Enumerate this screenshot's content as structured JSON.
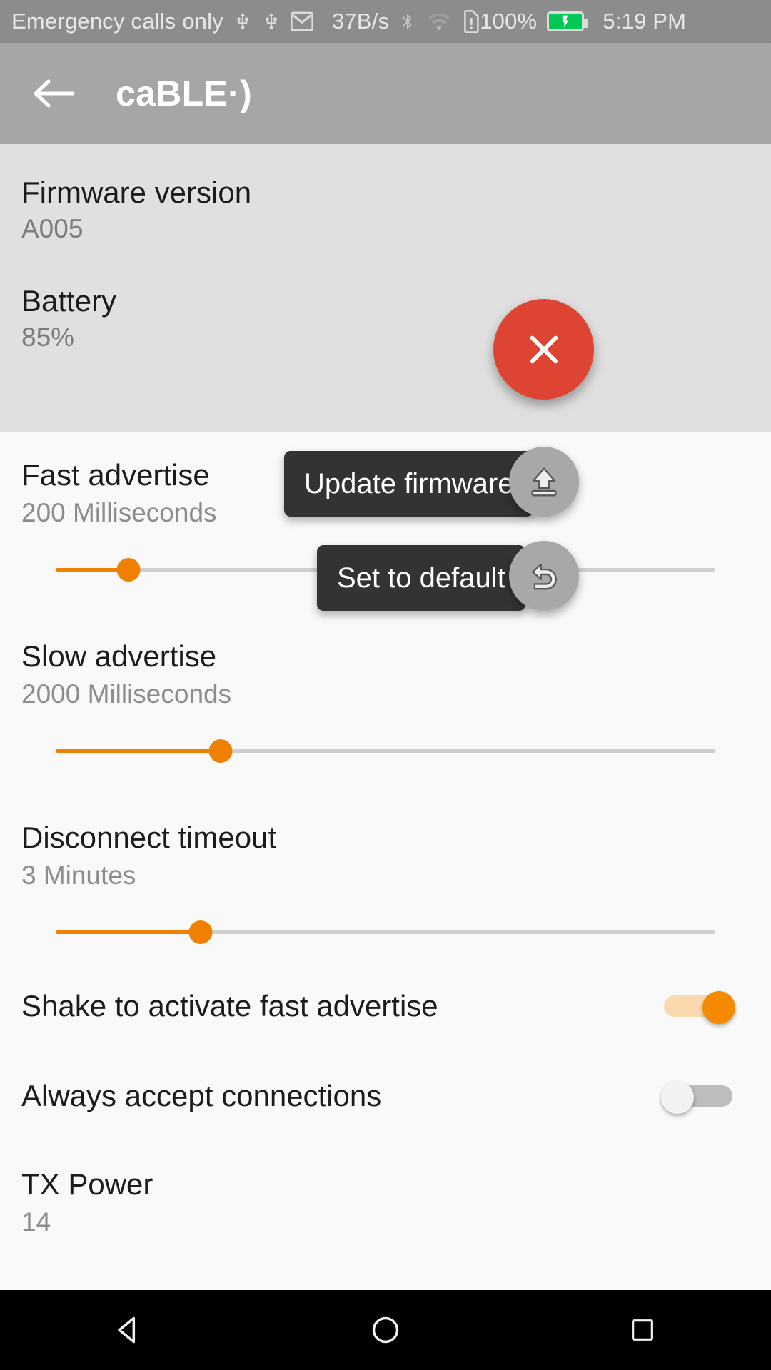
{
  "status_bar": {
    "carrier_text": "Emergency calls only",
    "icons": [
      "usb-icon",
      "usb-icon",
      "gmail-icon"
    ],
    "network_speed": "37B/s",
    "bluetooth_icon": "bluetooth-icon",
    "wifi_icon": "wifi-icon",
    "sim_alert_icon": "sim-card-alert-icon",
    "battery_percent": "100%",
    "battery_icon": "battery-charging-icon",
    "battery_color": "#00c853",
    "clock": "5:19 PM"
  },
  "app_bar": {
    "back_icon": "arrow-back-icon",
    "title": "caBLE·)"
  },
  "device_info": {
    "firmware": {
      "label": "Firmware version",
      "value": "A005"
    },
    "battery": {
      "label": "Battery",
      "value": "85%"
    }
  },
  "fab": {
    "close": {
      "icon": "close-icon",
      "color": "#dd4432"
    },
    "update_firmware": {
      "tooltip": "Update firmware",
      "icon": "upload-icon",
      "color": "#a8a8a8"
    },
    "set_to_default": {
      "tooltip": "Set to default",
      "icon": "undo-icon",
      "color": "#a8a8a8"
    }
  },
  "settings": {
    "accent_color": "#f08000",
    "sliders": [
      {
        "label": "Fast advertise",
        "value": "200 Milliseconds",
        "percent": 11
      },
      {
        "label": "Slow advertise",
        "value": "2000 Milliseconds",
        "percent": 25
      },
      {
        "label": "Disconnect timeout",
        "value": "3 Minutes",
        "percent": 22
      }
    ],
    "toggles": [
      {
        "label": "Shake to activate fast advertise",
        "state": "on"
      },
      {
        "label": "Always accept connections",
        "state": "off"
      }
    ],
    "tx_power": {
      "label": "TX Power",
      "value": "14"
    }
  },
  "nav_bar": {
    "back": "nav-back-triangle-icon",
    "home": "nav-home-circle-icon",
    "recents": "nav-recents-square-icon"
  }
}
